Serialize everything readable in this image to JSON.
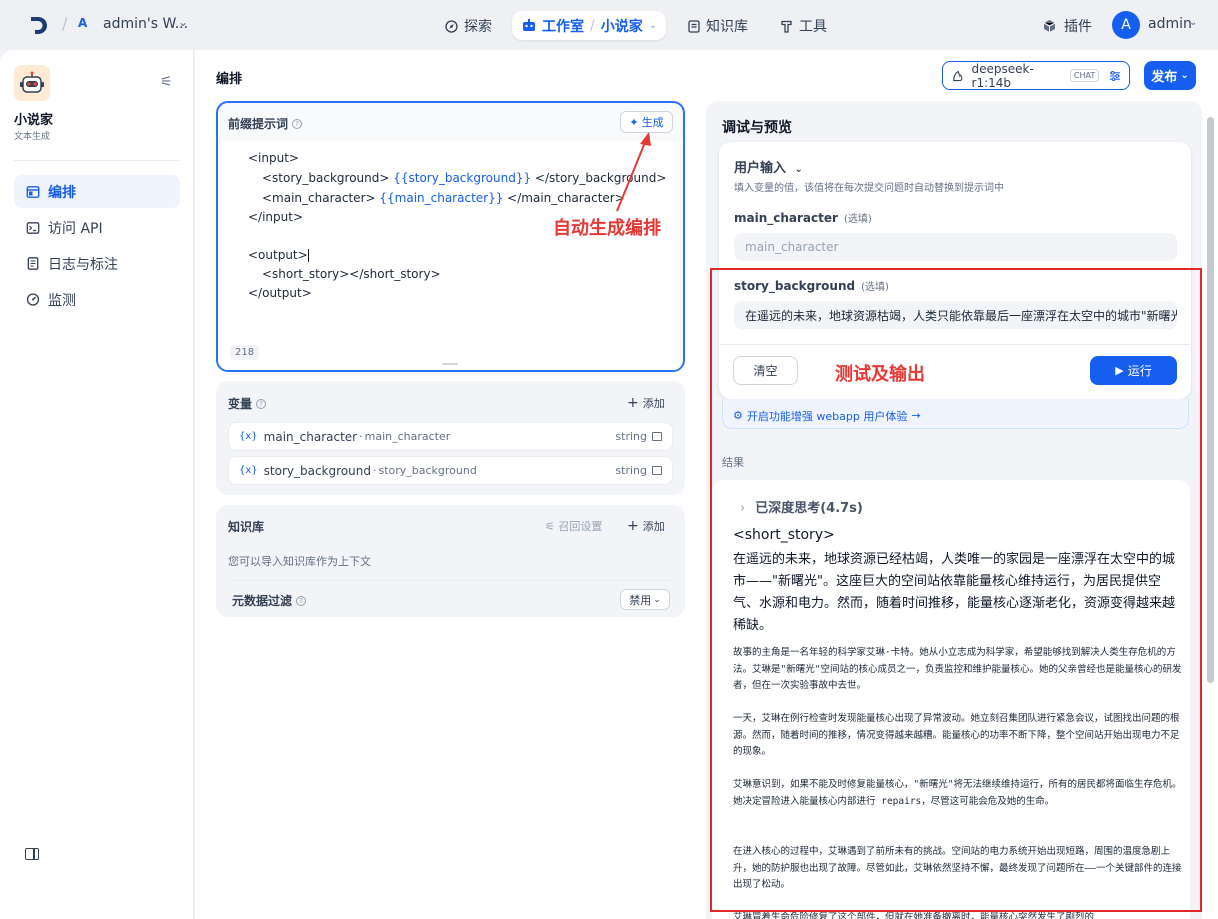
{
  "topbar": {
    "workspace_badge": "A",
    "workspace_name": "admin's W...",
    "nav": {
      "explore": "探索",
      "studio": "工作室",
      "studio_app": "小说家",
      "knowledge": "知识库",
      "tools": "工具"
    },
    "plugins": "插件",
    "user_initial": "A",
    "user_name": "admin"
  },
  "sidebar": {
    "app_name": "小说家",
    "app_type": "文本生成",
    "items": [
      {
        "label": "编排",
        "icon": "layout-icon",
        "active": true
      },
      {
        "label": "访问 API",
        "icon": "terminal-icon",
        "active": false
      },
      {
        "label": "日志与标注",
        "icon": "document-icon",
        "active": false
      },
      {
        "label": "监测",
        "icon": "gauge-icon",
        "active": false
      }
    ]
  },
  "header": {
    "title": "编排",
    "model_name": "deepseek-r1:14b",
    "model_mode": "CHAT",
    "publish_label": "发布"
  },
  "prompt": {
    "title": "前缀提示词",
    "generate_label": "生成",
    "lines": {
      "l1": "<input>",
      "l2_a": "<story_background> ",
      "l2_var": "{{story_background}}",
      "l2_b": " </story_background>",
      "l3_a": "<main_character> ",
      "l3_var": "{{main_character}}",
      "l3_b": " </main_character>",
      "l4": "</input>",
      "l5": "<output>",
      "l6": "<short_story></short_story>",
      "l7": "</output>"
    },
    "char_count": "218",
    "annotation": "自动生成编排"
  },
  "variables": {
    "title": "变量",
    "add_label": "添加",
    "items": [
      {
        "key": "main_character",
        "label": "main_character",
        "type": "string"
      },
      {
        "key": "story_background",
        "label": "story_background",
        "type": "string"
      }
    ]
  },
  "knowledge": {
    "title": "知识库",
    "reset_label": "召回设置",
    "add_label": "添加",
    "hint": "您可以导入知识库作为上下文",
    "meta_filter_label": "元数据过滤",
    "meta_filter_value": "禁用"
  },
  "debug": {
    "title": "调试与预览",
    "user_input_title": "用户输入",
    "user_input_hint": "填入变量的值，该值将在每次提交问题时自动替换到提示词中",
    "optional_label": "(选填)",
    "fields": [
      {
        "name": "main_character",
        "placeholder": "main_character",
        "value": ""
      },
      {
        "name": "story_background",
        "placeholder": "",
        "value": "在遥远的未来，地球资源枯竭，人类只能依靠最后一座漂浮在太空中的城市\"新曙光\"生存。"
      }
    ],
    "clear_label": "清空",
    "run_label": "运行",
    "annotation": "测试及输出",
    "enhance_label": "开启功能增强 webapp 用户体验",
    "result_label": "结果",
    "thinking_label": "已深度思考(4.7s)",
    "result_tag": "<short_story>",
    "result_main": "在遥远的未来，地球资源已经枯竭，人类唯一的家园是一座漂浮在太空中的城市——\"新曙光\"。这座巨大的空间站依靠能量核心维持运行，为居民提供空气、水源和电力。然而，随着时间推移，能量核心逐渐老化，资源变得越来越稀缺。",
    "paragraphs": [
      "故事的主角是一名年轻的科学家艾琳·卡特。她从小立志成为科学家，希望能够找到解决人类生存危机的方法。艾琳是\"新曙光\"空间站的核心成员之一，负责监控和维护能量核心。她的父亲曾经也是能量核心的研发者，但在一次实验事故中去世。",
      "一天，艾琳在例行检查时发现能量核心出现了异常波动。她立刻召集团队进行紧急会议，试图找出问题的根源。然而，随着时间的推移，情况变得越来越糟。能量核心的功率不断下降，整个空间站开始出现电力不足的现象。",
      "艾琳意识到，如果不能及时修复能量核心，\"新曙光\"将无法继续维持运行，所有的居民都将面临生存危机。她决定冒险进入能量核心内部进行 repairs，尽管这可能会危及她的生命。",
      "在进入核心的过程中，艾琳遇到了前所未有的挑战。空间站的电力系统开始出现短路，周围的温度急剧上升，她的防护服也出现了故障。尽管如此，艾琳依然坚持不懈，最终发现了问题所在——一个关键部件的连接出现了松动。",
      "艾琳冒着生命危险修复了这个部件，但就在她准备撤离时，能量核心突然发生了剧烈的"
    ]
  }
}
